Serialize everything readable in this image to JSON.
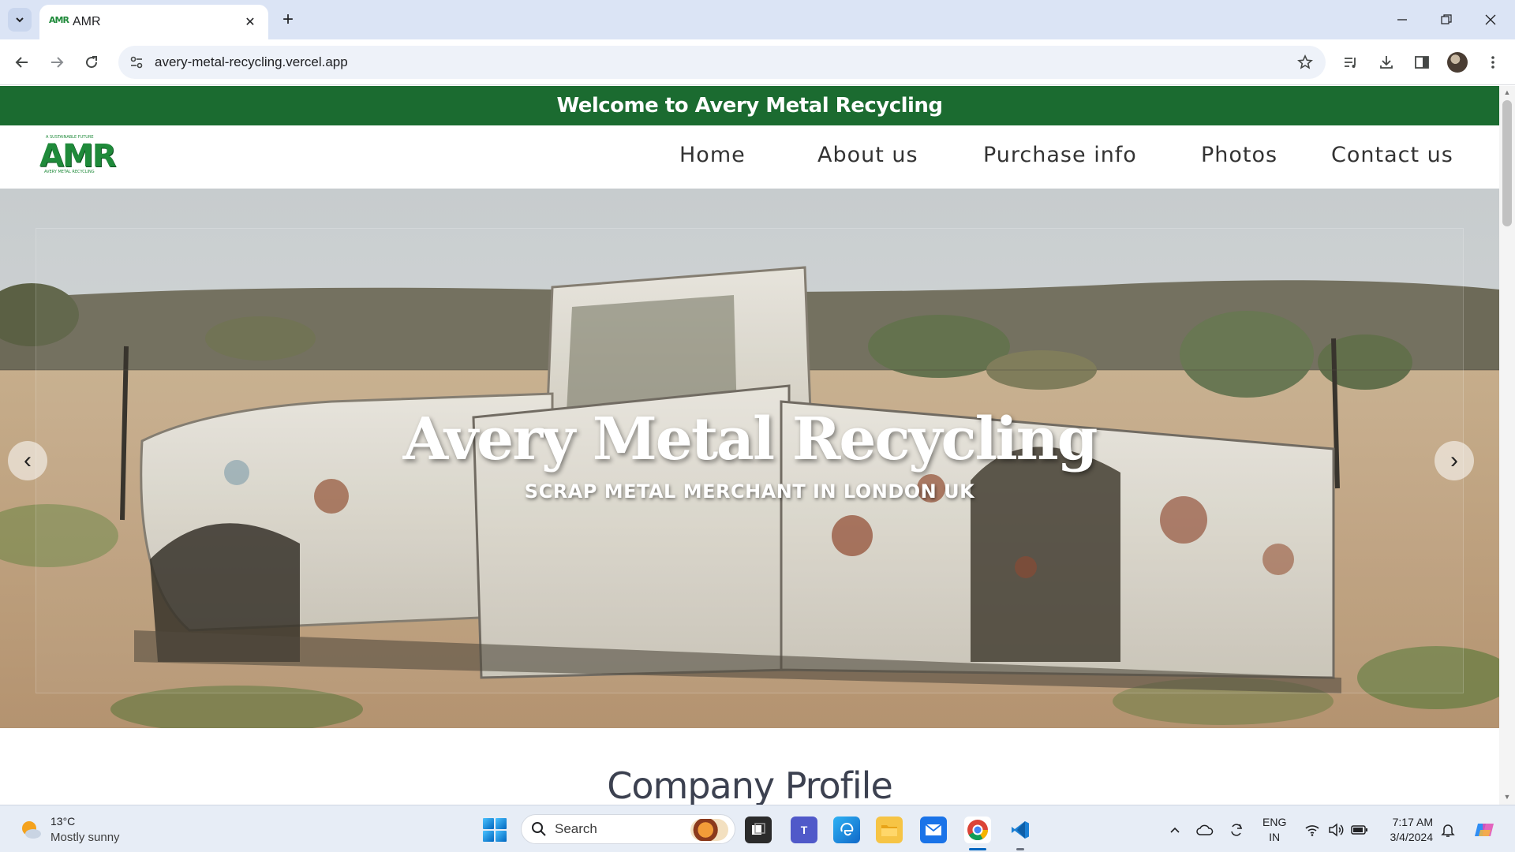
{
  "browser": {
    "tab_title": "AMR",
    "favicon_text": "AMR",
    "url": "avery-metal-recycling.vercel.app"
  },
  "site": {
    "welcome": "Welcome to Avery Metal Recycling",
    "logo": {
      "text": "AMR",
      "tagline": "A SUSTAINABLE FUTURE",
      "subline": "AVERY METAL RECYCLING"
    },
    "nav": [
      {
        "label": "Home"
      },
      {
        "label": "About us"
      },
      {
        "label": "Purchase info"
      },
      {
        "label": "Photos"
      },
      {
        "label": "Contact us"
      }
    ],
    "hero": {
      "title": "Avery Metal Recycling",
      "subtitle": "SCRAP METAL MERCHANT IN LONDON UK",
      "prev_symbol": "‹",
      "next_symbol": "›"
    },
    "section_heading": "Company Profile"
  },
  "taskbar": {
    "weather": {
      "temp": "13°C",
      "desc": "Mostly sunny"
    },
    "search_label": "Search",
    "lang": {
      "line1": "ENG",
      "line2": "IN"
    },
    "clock": {
      "time": "7:17 AM",
      "date": "3/4/2024"
    }
  },
  "colors": {
    "brand_green": "#1b6b30",
    "logo_green": "#1f8a3a",
    "accent_blue": "#0067c0"
  }
}
